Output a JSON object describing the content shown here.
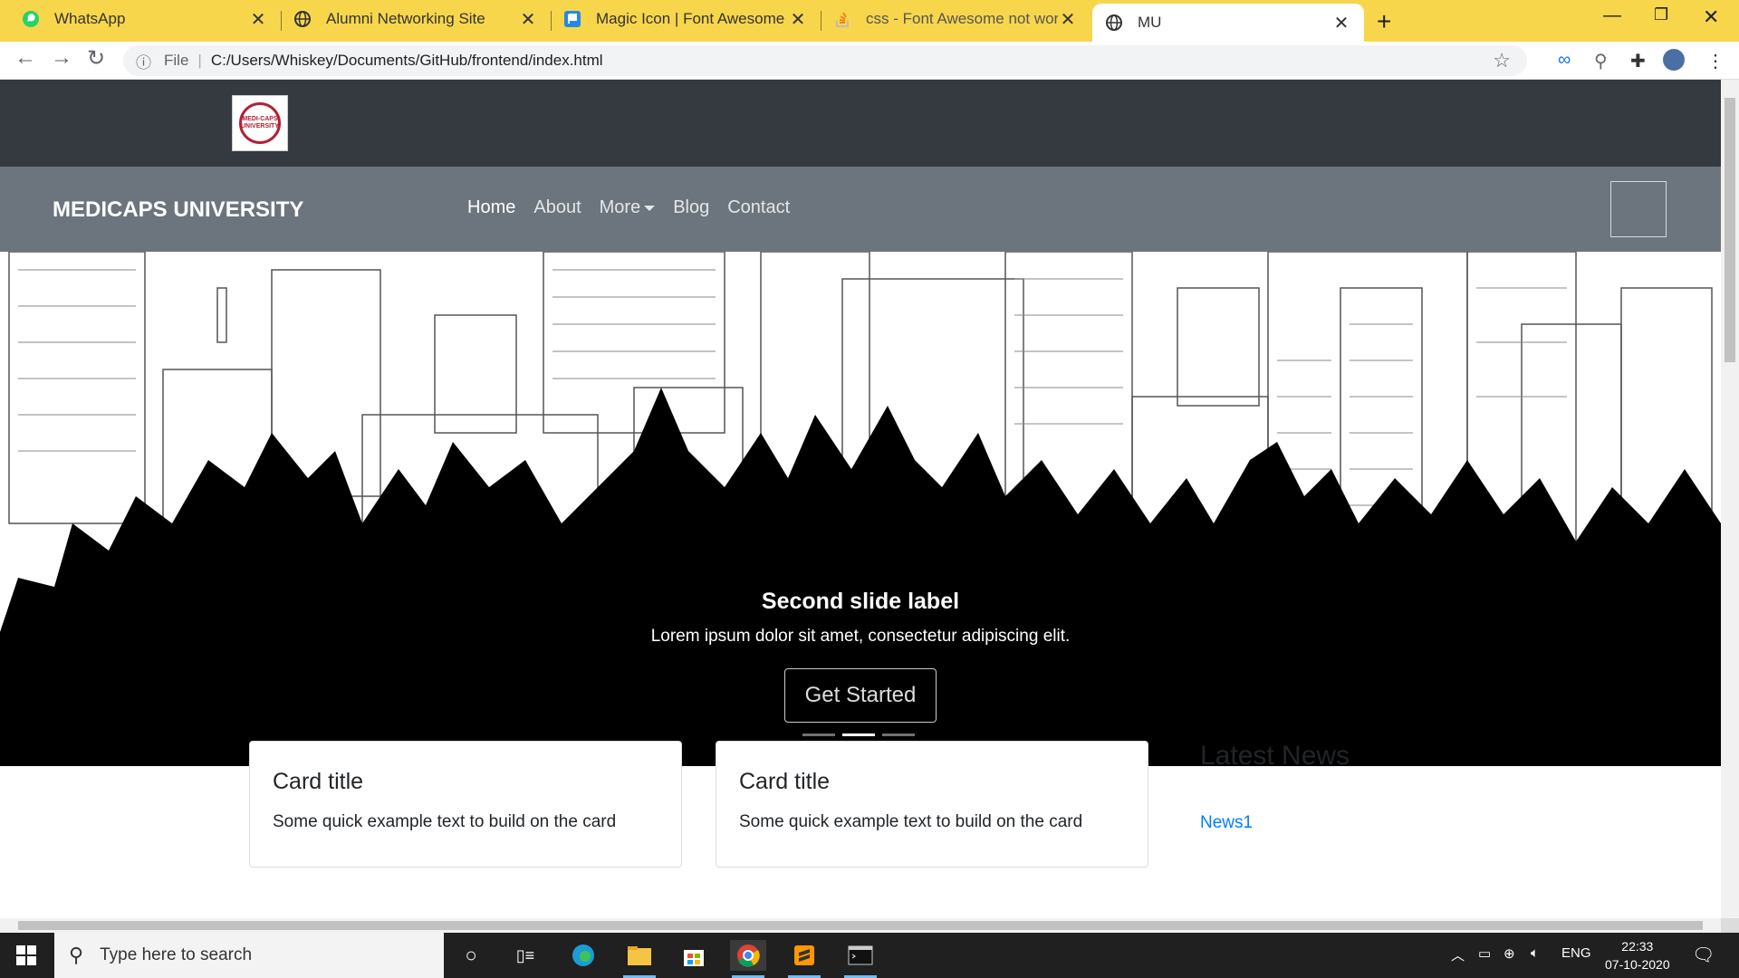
{
  "browser": {
    "tabs": [
      {
        "title": "WhatsApp",
        "icon": "whatsapp-icon"
      },
      {
        "title": "Alumni Networking Site",
        "icon": "globe-icon"
      },
      {
        "title": "Magic Icon | Font Awesome",
        "icon": "font-awesome-icon"
      },
      {
        "title": "css - Font Awesome not working",
        "icon": "stackoverflow-icon"
      },
      {
        "title": "MU",
        "icon": "globe-icon"
      }
    ],
    "active_tab_index": 4,
    "address": {
      "scheme_label": "File",
      "url": "C:/Users/Whiskey/Documents/GitHub/frontend/index.html"
    }
  },
  "site": {
    "brand": "MEDICAPS UNIVERSITY",
    "logo_text": "MEDI-CAPS UNIVERSITY",
    "nav": [
      {
        "label": "Home",
        "active": true
      },
      {
        "label": "About",
        "active": false
      },
      {
        "label": "More",
        "active": false,
        "dropdown": true
      },
      {
        "label": "Blog",
        "active": false
      },
      {
        "label": "Contact",
        "active": false
      }
    ],
    "carousel": {
      "title": "Second slide label",
      "text": "Lorem ipsum dolor sit amet, consectetur adipiscing elit.",
      "button": "Get Started",
      "slides": 3,
      "active_slide": 2
    },
    "cards": [
      {
        "title": "Card title",
        "text": "Some quick example text to build on the card"
      },
      {
        "title": "Card title",
        "text": "Some quick example text to build on the card"
      }
    ],
    "news": {
      "heading": "Latest News",
      "items": [
        "News1"
      ]
    }
  },
  "taskbar": {
    "search_placeholder": "Type here to search",
    "language": "ENG",
    "time": "22:33",
    "date": "07-10-2020"
  },
  "colors": {
    "tabstrip": "#f7d64b",
    "topband": "#343a40",
    "navbar": "#6c757d",
    "link": "#007bff"
  }
}
